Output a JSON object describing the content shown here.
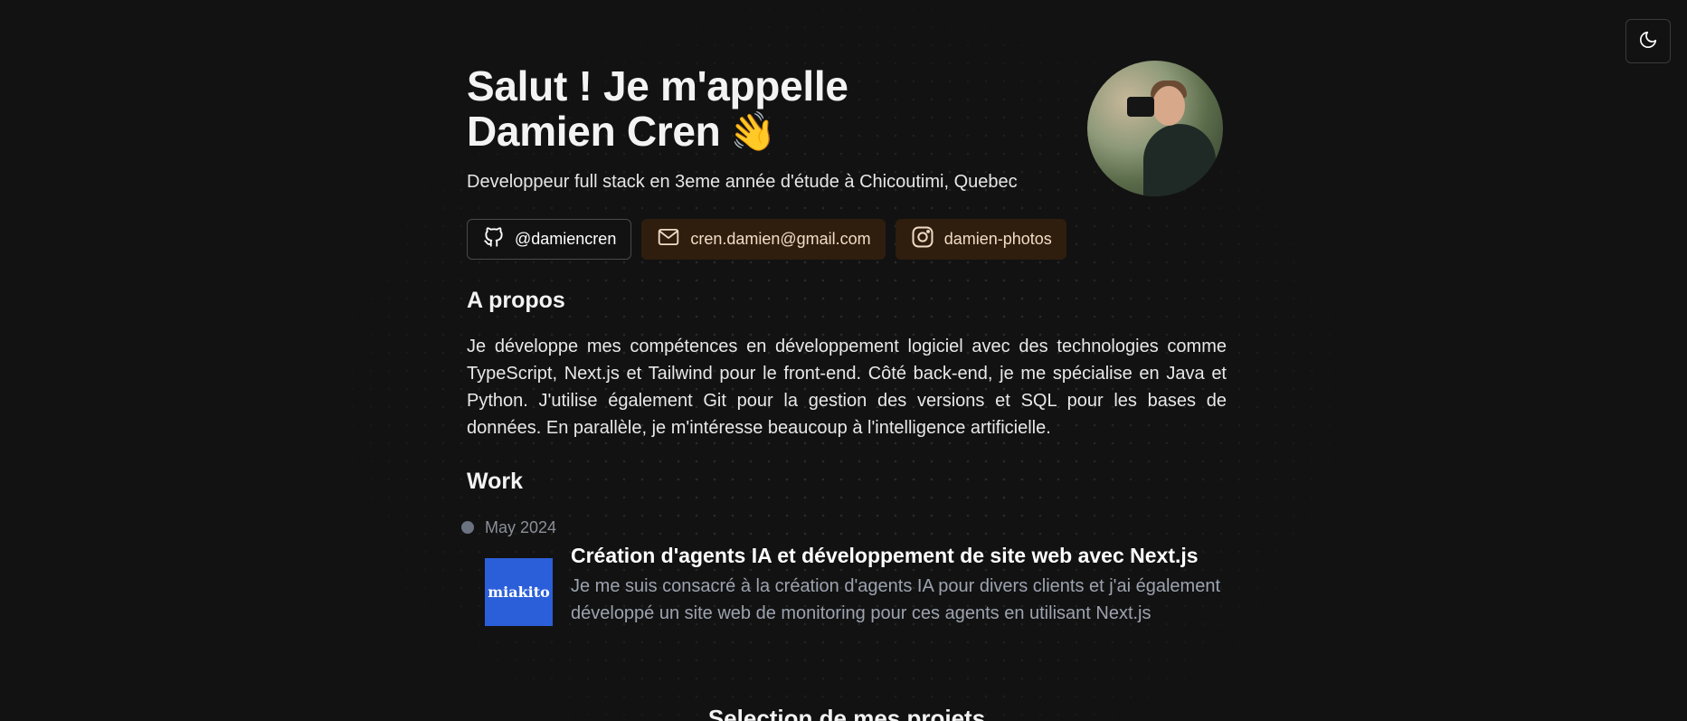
{
  "theme_toggle": {
    "icon": "moon-icon"
  },
  "hero": {
    "title_line1": "Salut ! Je m'appelle",
    "title_line2": "Damien Cren",
    "wave_emoji": "👋",
    "subtitle": "Developpeur full stack en 3eme année d'étude à Chicoutimi, Quebec"
  },
  "links": {
    "github": "@damiencren",
    "email": "cren.damien@gmail.com",
    "instagram": "damien-photos"
  },
  "about": {
    "heading": "A propos",
    "text": "Je développe mes compétences en développement logiciel avec des technologies comme TypeScript, Next.js et Tailwind pour le front-end. Côté back-end, je me spécialise en Java et Python. J'utilise également Git pour la gestion des versions et SQL pour les bases de données. En parallèle, je m'intéresse beaucoup à l'intelligence artificielle."
  },
  "work": {
    "heading": "Work",
    "items": [
      {
        "date": "May 2024",
        "logo_text": "miakito",
        "title": "Création d'agents IA et développement de site web avec Next.js",
        "description": "Je me suis consacré à la création d'agents IA pour divers clients et j'ai également développé un site web de monitoring pour ces agents en utilisant Next.js"
      }
    ]
  },
  "projects": {
    "heading": "Selection de mes projets"
  },
  "colors": {
    "background": "#121212",
    "brown_chip": "#2f1e0e",
    "logo_blue": "#2b5fd9",
    "muted_text": "#9ca3af"
  }
}
